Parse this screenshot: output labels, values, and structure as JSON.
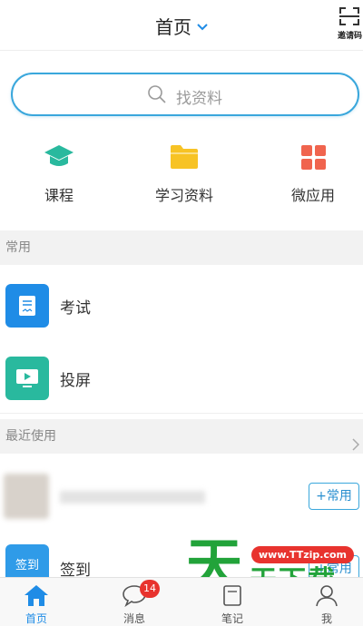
{
  "header": {
    "title": "首页",
    "invite_label": "邀请码"
  },
  "search": {
    "placeholder": "找资料"
  },
  "quick_links": [
    {
      "label": "课程",
      "icon": "graduation-cap-icon"
    },
    {
      "label": "学习资料",
      "icon": "folder-icon"
    },
    {
      "label": "微应用",
      "icon": "app-grid-icon"
    }
  ],
  "sections": {
    "common": "常用",
    "recent": "最近使用"
  },
  "common_items": [
    {
      "label": "考试",
      "icon": "exam-paper-icon"
    },
    {
      "label": "投屏",
      "icon": "screen-cast-icon"
    }
  ],
  "recent_items": [
    {
      "add_label": "+常用"
    },
    {
      "label": "签到",
      "tile_text": "签到",
      "add_label": "+常用"
    }
  ],
  "watermark": {
    "big_char": "天",
    "badge": "www.TTzip.com",
    "text": "天下载"
  },
  "tabbar": [
    {
      "label": "首页",
      "icon": "home-icon",
      "active": true
    },
    {
      "label": "消息",
      "icon": "chat-bubble-icon",
      "badge": "14"
    },
    {
      "label": "笔记",
      "icon": "note-icon"
    },
    {
      "label": "我",
      "icon": "profile-icon"
    }
  ],
  "colors": {
    "accent": "#1f8ce6",
    "search_border": "#3aa7dc",
    "teal": "#29b99e",
    "folder": "#f7c325",
    "apps": "#f0644e",
    "badge": "#e8332e"
  }
}
